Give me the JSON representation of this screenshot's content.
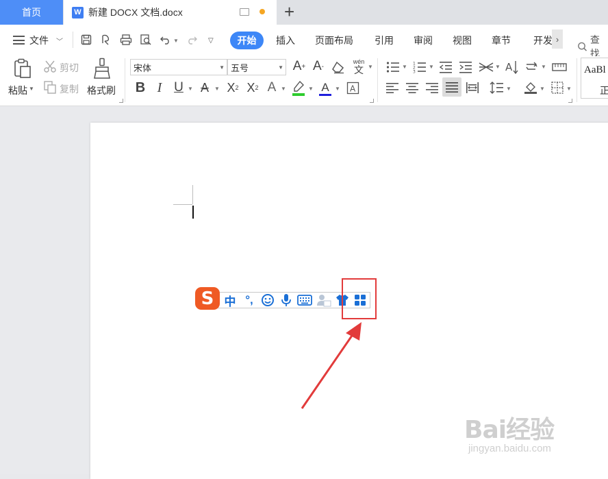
{
  "tabs": {
    "home": "首页",
    "doc_icon": "W",
    "doc_title": "新建 DOCX 文档.docx",
    "new_tab": "+"
  },
  "menubar": {
    "file": "文件",
    "tabs": [
      "开始",
      "插入",
      "页面布局",
      "引用",
      "审阅",
      "视图",
      "章节",
      "开发"
    ],
    "more": "›",
    "search": "查找"
  },
  "ribbon": {
    "paste": "粘贴",
    "cut": "剪切",
    "copy": "复制",
    "format_painter": "格式刷",
    "font_name": "宋体",
    "font_size": "五号",
    "phonetic": "wén",
    "bold": "B",
    "italic": "I",
    "underline": "U",
    "style_preview": "AaBl",
    "style_name": "正"
  },
  "ime": {
    "logo": "S",
    "mode": "中",
    "punct": "°,"
  },
  "watermark": {
    "brand": "Bai经验",
    "url": "jingyan.baidu.com"
  },
  "colors": {
    "accent": "#3d87f7",
    "home_tab": "#4e8ef7",
    "ime_blue": "#1a6fd6",
    "ime_logo": "#ef5a24",
    "highlight": "#e23b3b"
  }
}
